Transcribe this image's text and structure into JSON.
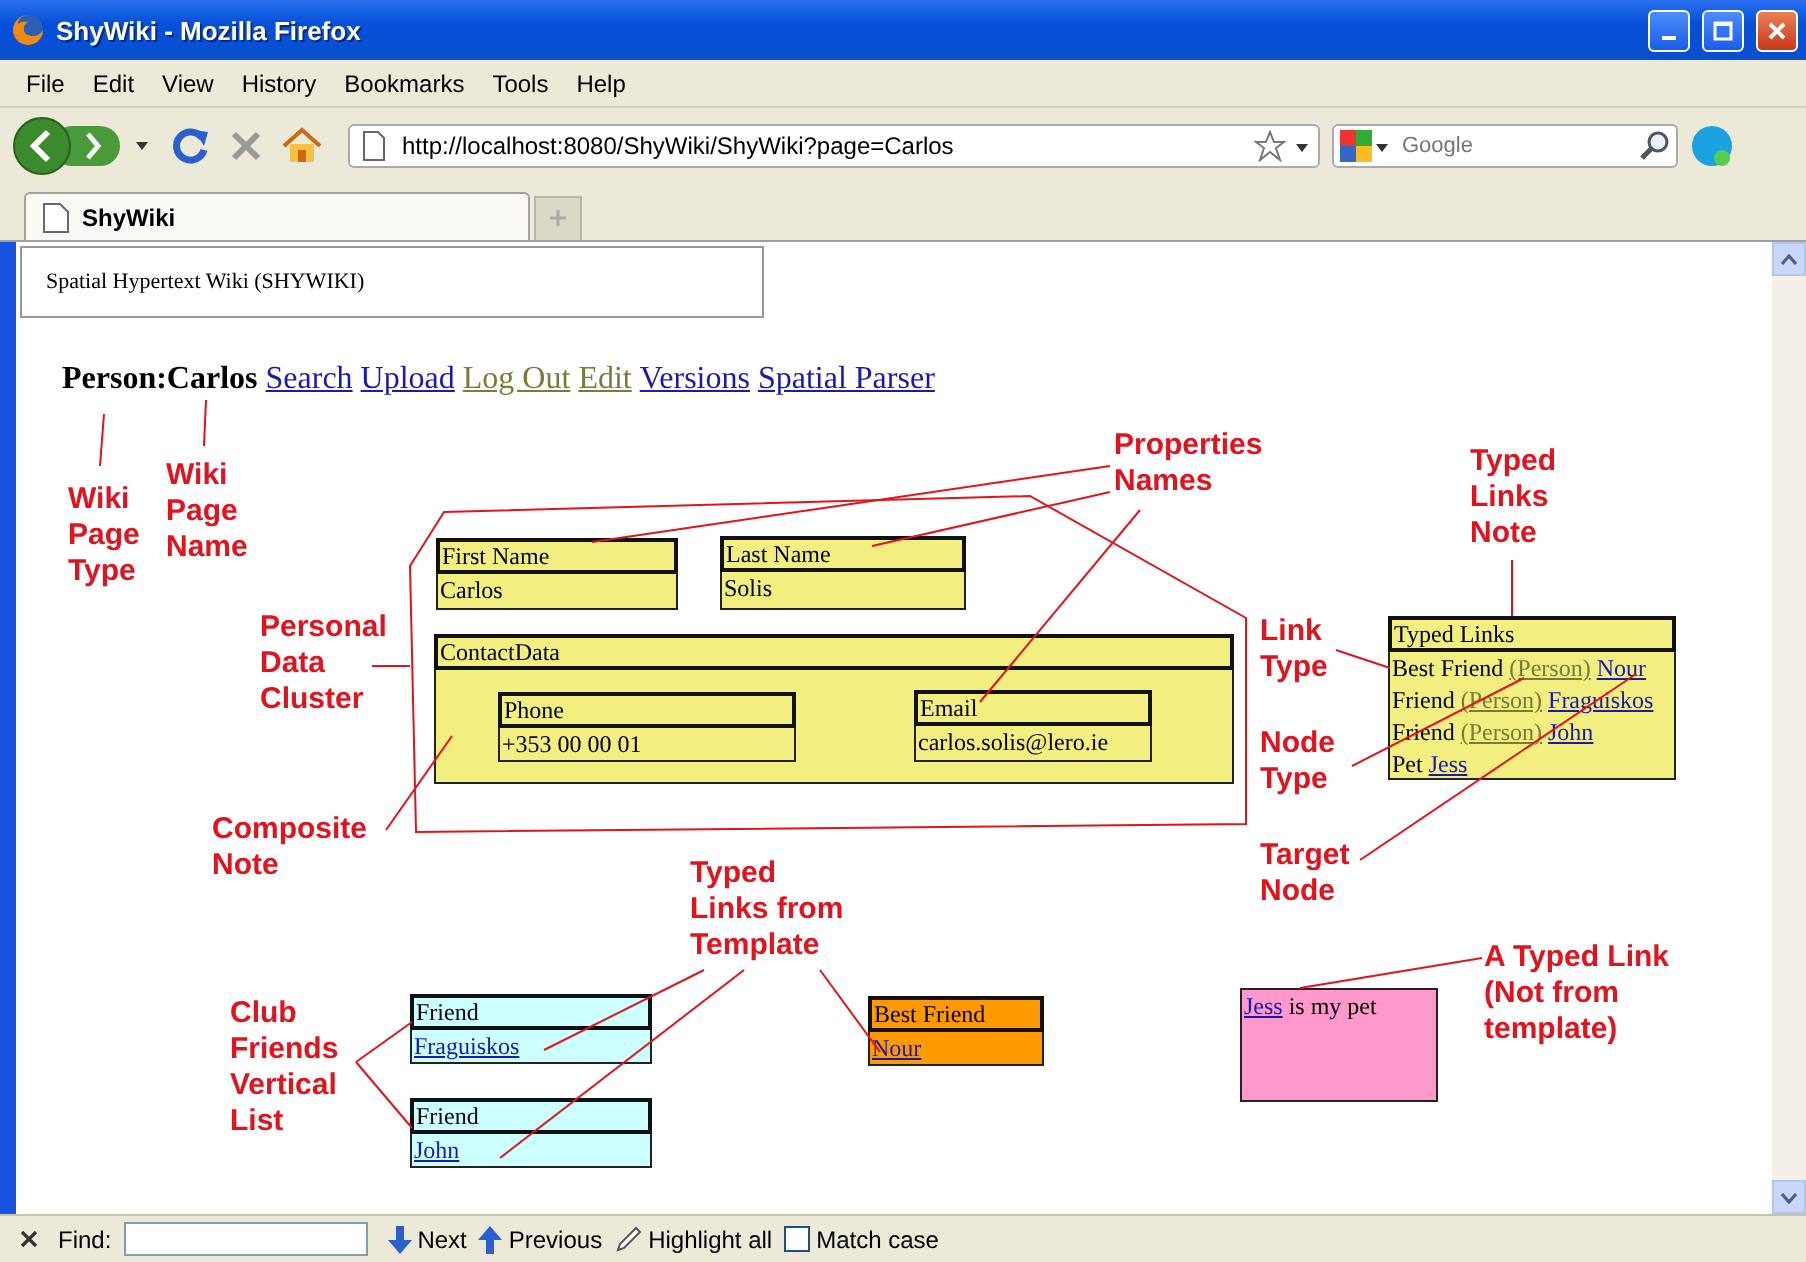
{
  "window": {
    "title": "ShyWiki - Mozilla Firefox"
  },
  "menu": [
    "File",
    "Edit",
    "View",
    "History",
    "Bookmarks",
    "Tools",
    "Help"
  ],
  "address": {
    "value": "http://localhost:8080/ShyWiki/ShyWiki?page=Carlos"
  },
  "search": {
    "placeholder": "Google"
  },
  "tabs": [
    {
      "label": "ShyWiki",
      "selected": true
    }
  ],
  "page": {
    "banner": "Spatial Hypertext Wiki (SHYWIKI)",
    "page_title": "Person:Carlos",
    "links": [
      {
        "label": "Search",
        "visited": false
      },
      {
        "label": "Upload",
        "visited": false
      },
      {
        "label": "Log Out",
        "visited": true
      },
      {
        "label": "Edit",
        "visited": true
      },
      {
        "label": "Versions",
        "visited": false
      },
      {
        "label": "Spatial Parser",
        "visited": false
      }
    ]
  },
  "notes": [
    {
      "kind": "property",
      "color": "#f3ee80",
      "header": "First Name",
      "value": "Carlos"
    },
    {
      "kind": "property",
      "color": "#f3ee80",
      "header": "Last Name",
      "value": "Solis"
    },
    {
      "kind": "composite",
      "color": "#f3ee80",
      "header": "ContactData",
      "children": [
        {
          "kind": "property",
          "color": "#f3ee80",
          "header": "Phone",
          "value": "+353 00 00 01"
        },
        {
          "kind": "property",
          "color": "#f3ee80",
          "header": "Email",
          "value": "carlos.solis@lero.ie"
        }
      ]
    },
    {
      "kind": "links",
      "color": "#f3ee80",
      "header": "Typed Links",
      "rows": [
        {
          "type": "Best Friend",
          "node_type": "(Person)",
          "target": "Nour"
        },
        {
          "type": "Friend",
          "node_type": "(Person)",
          "target": "Fraguiskos"
        },
        {
          "type": "Friend",
          "node_type": "(Person)",
          "target": "John"
        },
        {
          "type": "Pet",
          "target": "Jess"
        }
      ]
    },
    {
      "kind": "property",
      "color": "#ccffff",
      "header": "Friend",
      "link": "Fraguiskos"
    },
    {
      "kind": "property",
      "color": "#ccffff",
      "header": "Friend",
      "link": "John"
    },
    {
      "kind": "property",
      "color": "#ff9900",
      "header": "Best Friend",
      "link": "Nour"
    },
    {
      "kind": "text",
      "color": "#ff99cc",
      "link": "Jess",
      "text": "is my pet"
    }
  ],
  "annotations": [
    "Wiki\nPage\nType",
    "Wiki\nPage\nName",
    "Personal\nData\nCluster",
    "Composite\nNote",
    "Properties\nNames",
    "Typed\nLinks\nNote",
    "Link\nType",
    "Node\nType",
    "Target\nNode",
    "Typed\nLinks from\nTemplate",
    "Club\nFriends\nVertical\nList",
    "A Typed Link\n(Not from\ntemplate)"
  ],
  "find_bar": {
    "label": "Find:",
    "next": "Next",
    "previous": "Previous",
    "highlight": "Highlight all",
    "match_case": {
      "label": "Match case",
      "checked": false
    }
  }
}
